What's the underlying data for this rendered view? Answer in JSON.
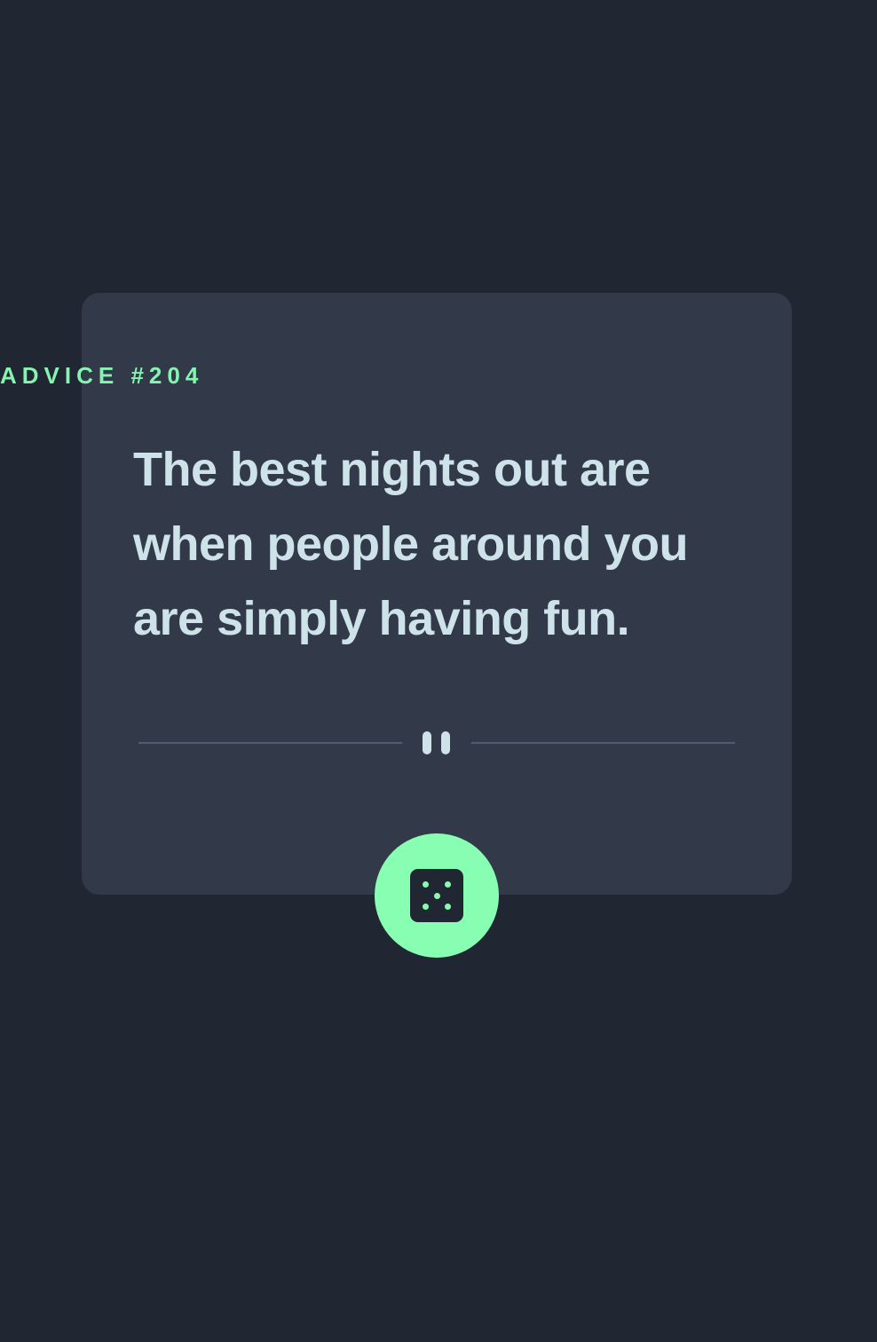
{
  "advice": {
    "label": "ADVICE #204",
    "text": "The best nights out are when people around you are simply having fun."
  },
  "divider": {
    "icon": "pause-icon"
  },
  "dice_button": {
    "icon": "dice-icon"
  },
  "colors": {
    "background": "#202632",
    "card": "#323a49",
    "accent": "#88feb2",
    "text": "#cee3e9",
    "divider": "#4f5d74"
  }
}
